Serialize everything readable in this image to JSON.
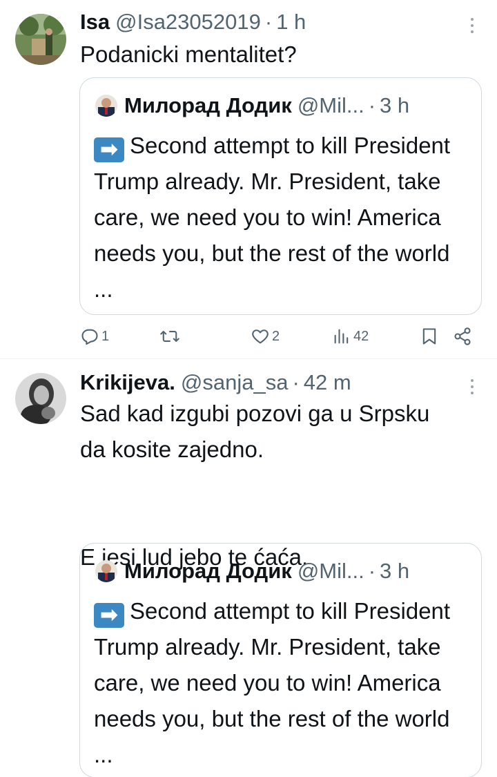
{
  "tweets": [
    {
      "author": {
        "name": "Isa",
        "handle": "@Isa23052019",
        "sep": "·",
        "time": "1 h"
      },
      "text": "Podanicki mentalitet?",
      "quote": {
        "name": "Милорад Додик",
        "handle": "@Mil...",
        "sep": "·",
        "time": "3 h",
        "emoji": "➡",
        "text": "Second attempt to kill President Trump already. Mr. President, take care, we need you to win!  America needs you, but the rest of the world ..."
      },
      "stats": {
        "replies": "1",
        "likes": "2",
        "views": "42"
      }
    },
    {
      "author": {
        "name": "Krikijeva.",
        "handle": "@sanja_sa",
        "sep": "·",
        "time": "42 m"
      },
      "text": "Sad kad izgubi pozovi ga u Srpsku\nda kosite zajedno.\n\n\nE jesi lud jebo te ćaća.",
      "quote": {
        "name": "Милорад Додик",
        "handle": "@Mil...",
        "sep": "·",
        "time": "3 h",
        "emoji": "➡",
        "text": "Second attempt to kill President Trump already. Mr. President, take care, we need you to win!  America needs you, but the rest of the world ..."
      }
    }
  ],
  "icons": {
    "reply": "reply-icon",
    "retweet": "retweet-icon",
    "like": "like-icon",
    "views": "views-icon",
    "bookmark": "bookmark-icon",
    "share": "share-icon",
    "more": "more-icon"
  },
  "colors": {
    "text": "#0f1419",
    "muted": "#536471",
    "border": "#cfd9de",
    "divider": "#eff3f4"
  }
}
